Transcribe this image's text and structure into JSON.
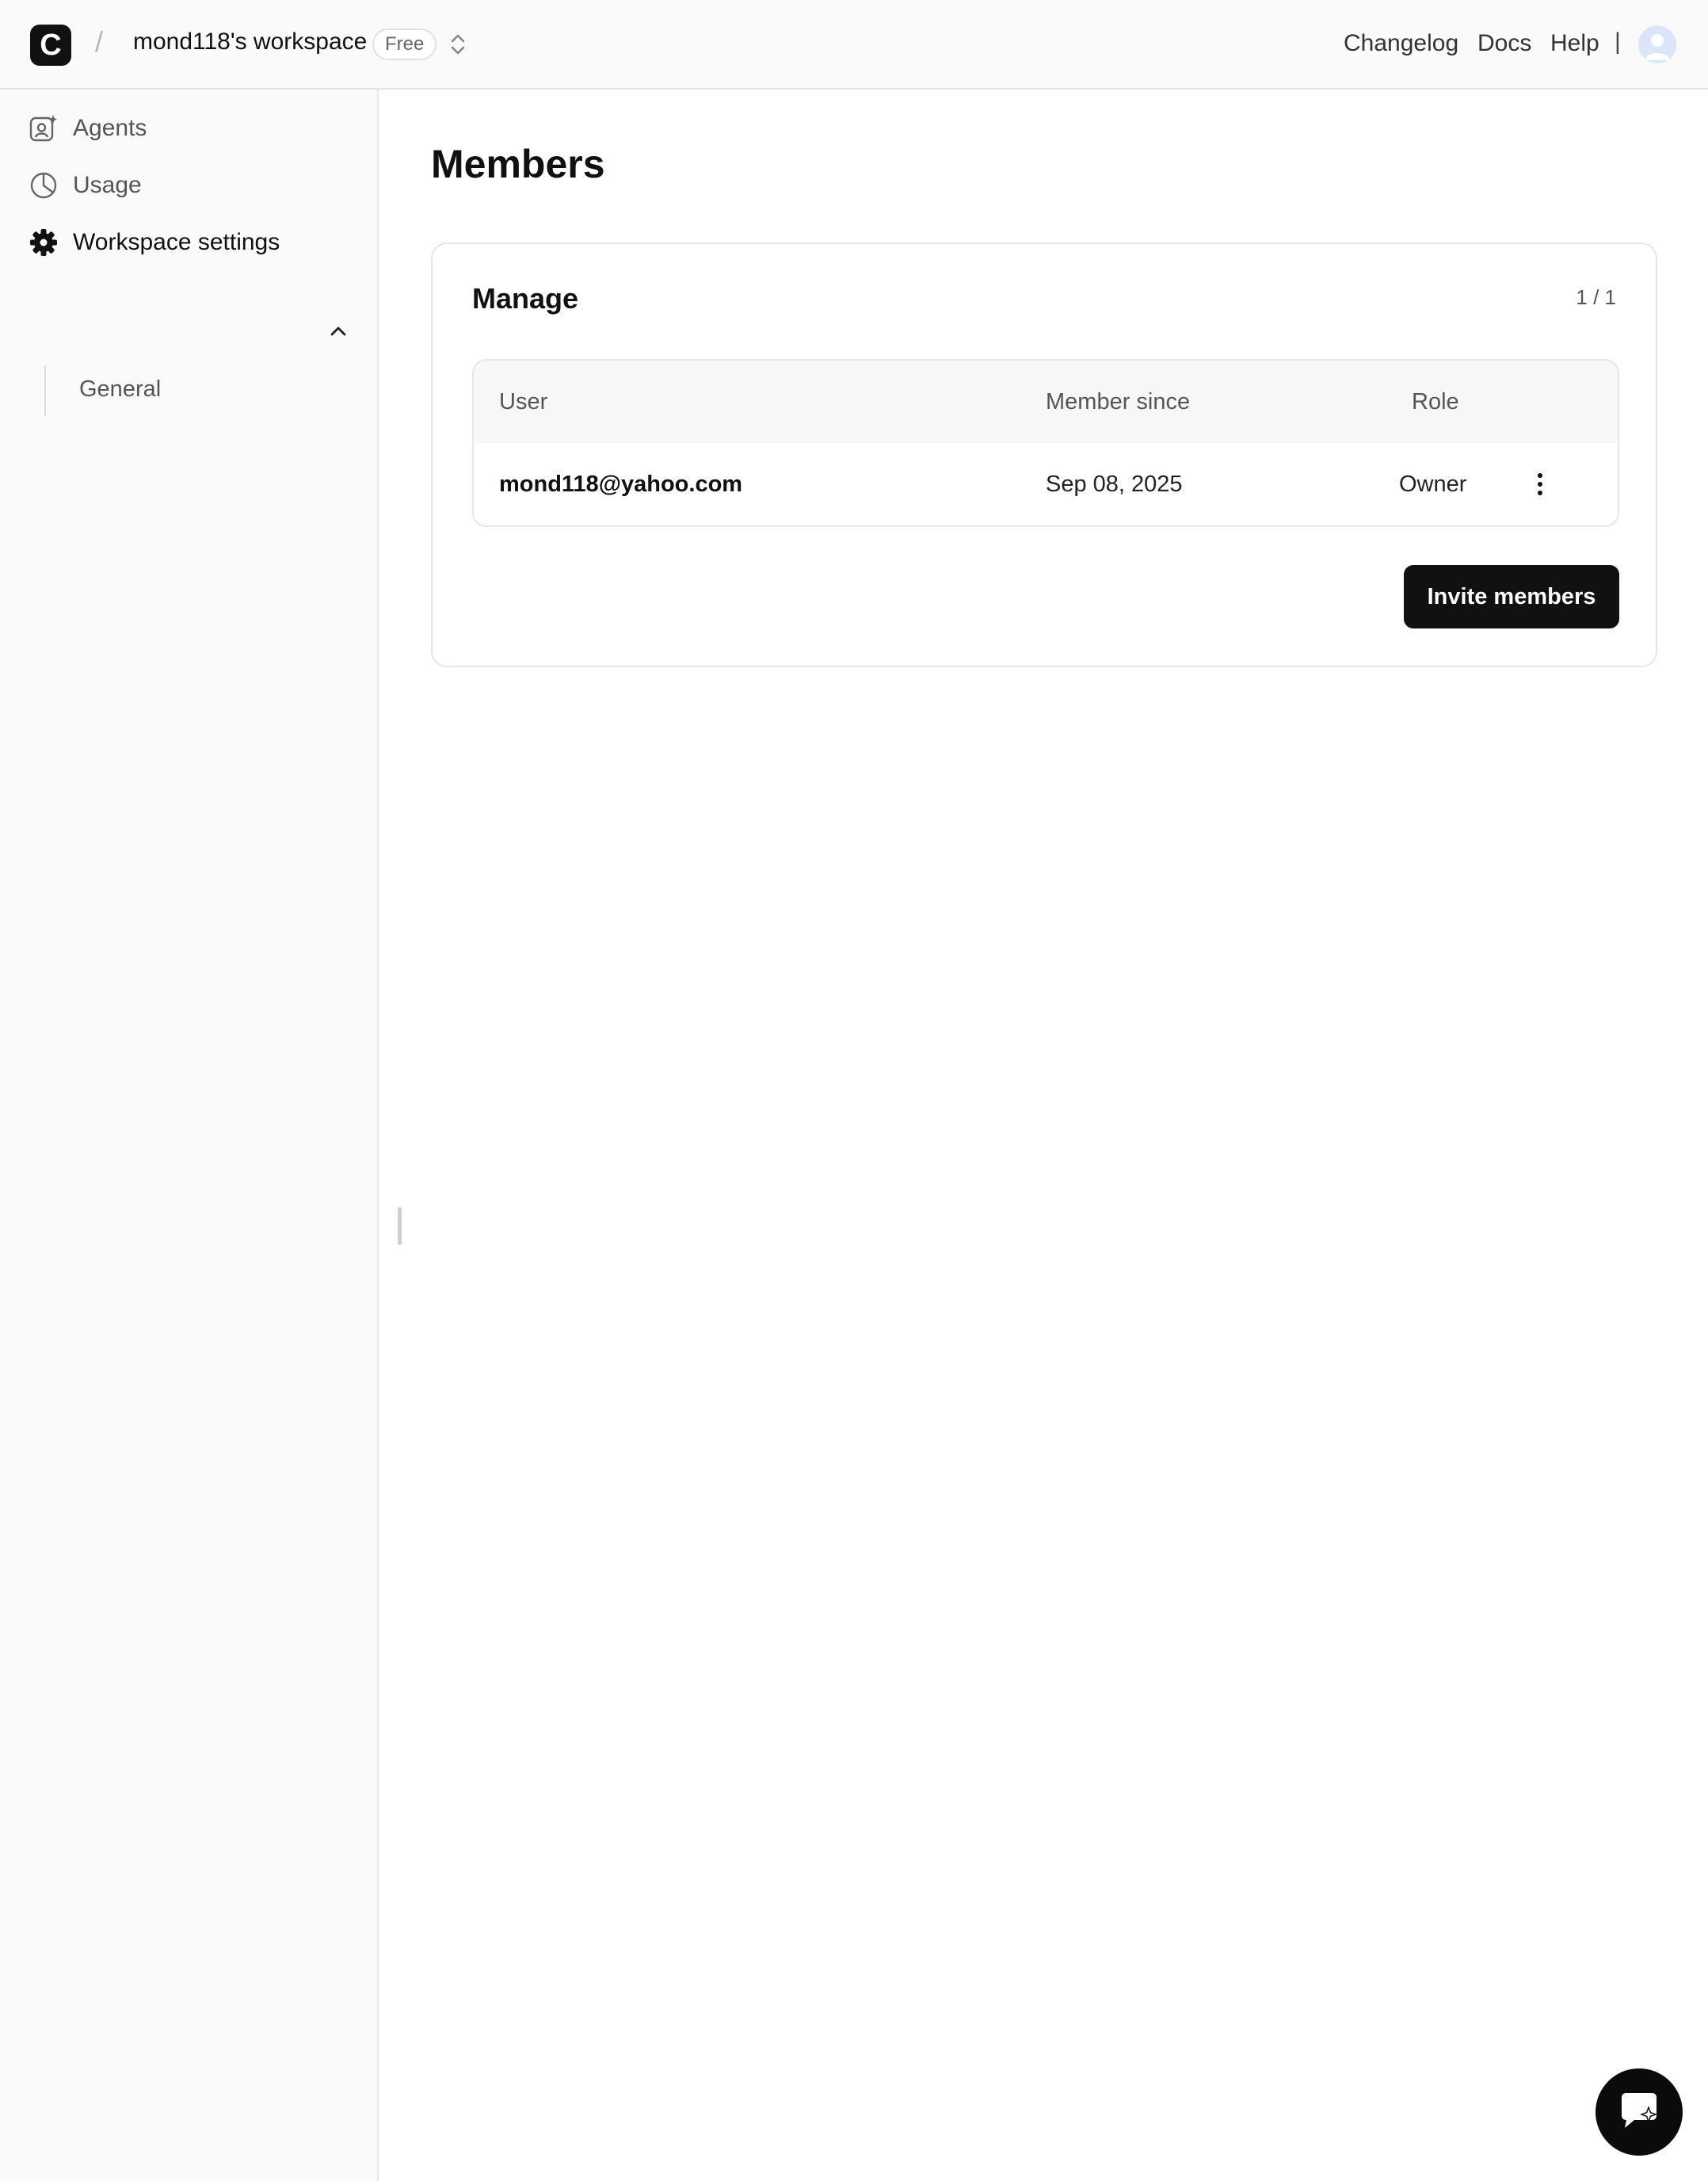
{
  "header": {
    "logo_letter": "C",
    "breadcrumb_separator": "/",
    "workspace_name": "mond118's workspace",
    "plan_badge": "Free",
    "links": [
      "Changelog",
      "Docs",
      "Help"
    ],
    "divider": "|"
  },
  "sidebar": {
    "items": [
      {
        "label": "Agents",
        "icon": "agents-icon"
      },
      {
        "label": "Usage",
        "icon": "usage-pie-icon"
      },
      {
        "label": "Workspace settings",
        "icon": "gear-icon"
      }
    ],
    "subitems": [
      {
        "label": "General"
      }
    ]
  },
  "main": {
    "title": "Members",
    "card": {
      "title": "Manage",
      "count": "1 / 1",
      "columns": [
        "User",
        "Member since",
        "Role"
      ],
      "rows": [
        {
          "user": "mond118@yahoo.com",
          "member_since": "Sep 08, 2025",
          "role": "Owner"
        }
      ],
      "invite_label": "Invite members"
    }
  },
  "colors": {
    "accent": "#111111",
    "background": "#ffffff",
    "sidebar": "#fafafa",
    "border": "#e6e6e6"
  }
}
